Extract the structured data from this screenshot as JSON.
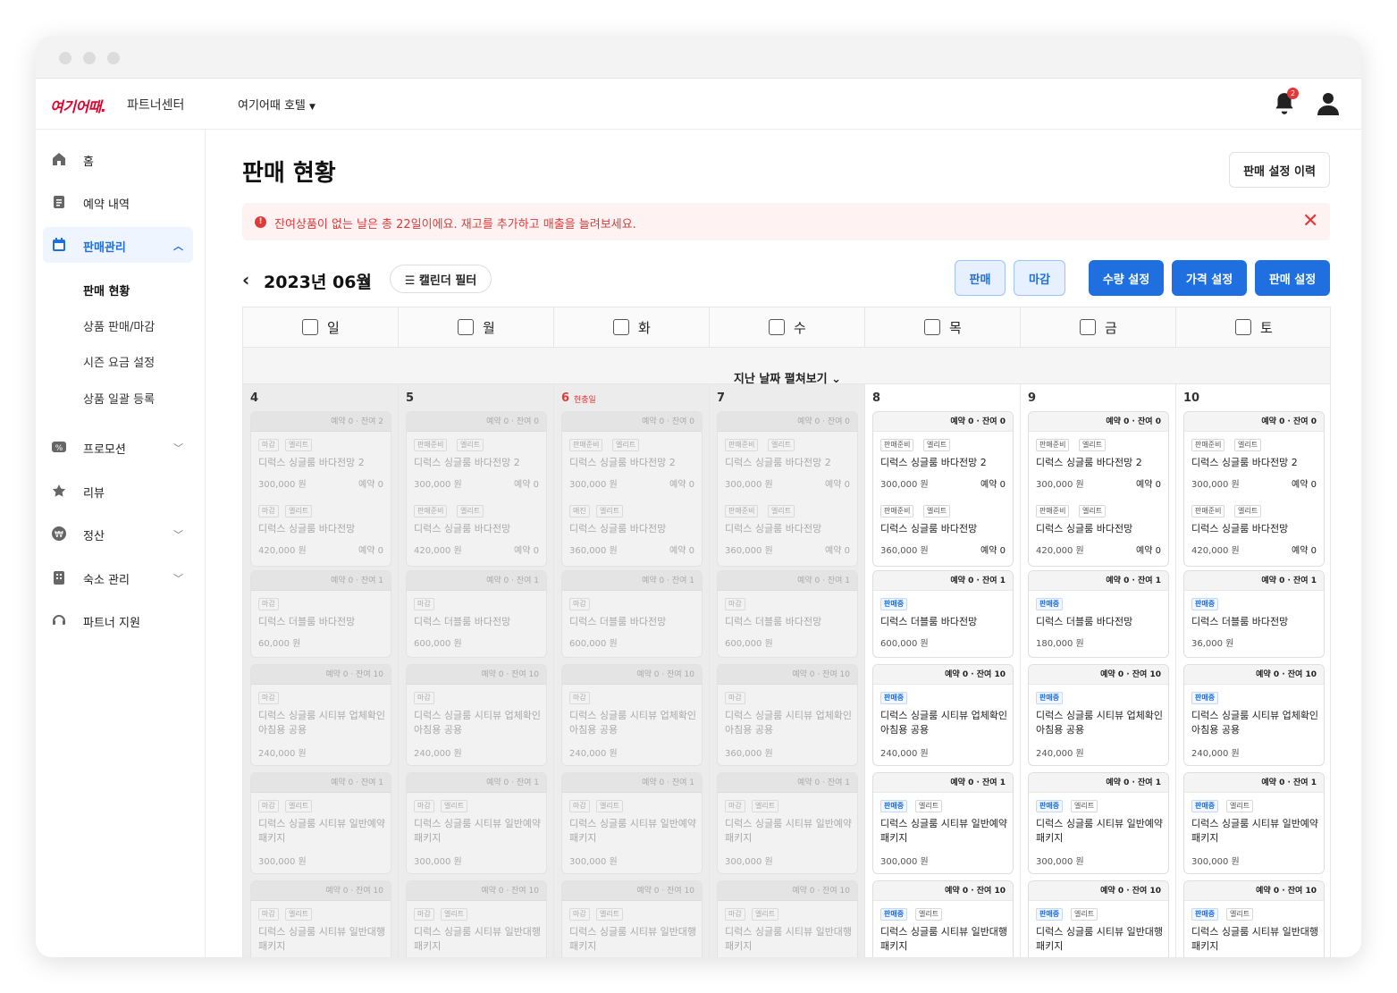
{
  "app": {
    "logo": "여기어때.",
    "logo_sub": "파트너센터",
    "hotel": "여기어때 호텔",
    "notif_count": "2"
  },
  "colors": {
    "accent": "#1f6fe0",
    "danger": "#e23838"
  },
  "sidebar": {
    "items": [
      {
        "label": "홈",
        "icon": "home-icon"
      },
      {
        "label": "예약 내역",
        "icon": "document-icon"
      },
      {
        "label": "판매관리",
        "icon": "calendar-icon"
      },
      {
        "label": "프로모션",
        "icon": "percent-icon"
      },
      {
        "label": "리뷰",
        "icon": "star-icon"
      },
      {
        "label": "정산",
        "icon": "won-icon"
      },
      {
        "label": "숙소 관리",
        "icon": "building-icon"
      },
      {
        "label": "파트너 지원",
        "icon": "headset-icon"
      }
    ],
    "subitems": [
      "판매 현황",
      "상품 판매/마감",
      "시즌 요금 설정",
      "상품 일괄 등록"
    ]
  },
  "main": {
    "title": "판매 현황",
    "history_button": "판매 설정 이력",
    "alert": "잔여상품이 없는 날은 총 22일이에요. 재고를 추가하고 매출을 늘려보세요.",
    "month": "2023년 06월",
    "filter_button": "캘린더 필터",
    "buttons": [
      "판매",
      "마감",
      "수량 설정",
      "가격 설정",
      "판매 설정"
    ],
    "expand_label": "지난 날짜 펼쳐보기"
  },
  "calendar": {
    "weekdays": [
      "일",
      "월",
      "화",
      "수",
      "목",
      "금",
      "토"
    ],
    "today_label": "현충일",
    "days": [
      {
        "num": "4",
        "past": true,
        "cards": [
          {
            "top": "예약 0 · 잔여 2",
            "rows": [
              {
                "tags": [
                  "마감",
                  "엘리트"
                ],
                "name": "디럭스 싱글룸 바다전망 2",
                "price": "300,000 원",
                "resv": "예약 0"
              },
              {
                "tags": [
                  "마감",
                  "엘리트"
                ],
                "name": "디럭스 싱글룸 바다전망",
                "price": "420,000 원",
                "resv": "예약 0"
              }
            ]
          },
          {
            "top": "예약 0 · 잔여 1",
            "rows": [
              {
                "tags": [
                  "마감"
                ],
                "name": "디럭스 더블룸 바다전망",
                "price": "60,000 원"
              }
            ]
          },
          {
            "top": "예약 0 · 잔여 10",
            "rows": [
              {
                "tags": [
                  "마감"
                ],
                "name": "디럭스 싱글룸 시티뷰 업체확인 아침용 공용",
                "price": "240,000 원"
              }
            ]
          },
          {
            "top": "예약 0 · 잔여 1",
            "rows": [
              {
                "tags": [
                  "마감",
                  "엘리트"
                ],
                "name": "디럭스 싱글룸 시티뷰 일반예약 패키지",
                "price": "300,000 원"
              }
            ]
          },
          {
            "top": "예약 0 · 잔여 10",
            "rows": [
              {
                "tags": [
                  "마감",
                  "엘리트"
                ],
                "name": "디럭스 싱글룸 시티뷰 일반대행 패키지"
              }
            ]
          }
        ]
      },
      {
        "num": "5",
        "past": true,
        "cards": [
          {
            "top": "예약 0 · 잔여 0",
            "rows": [
              {
                "tags": [
                  "판매준비",
                  "엘리트"
                ],
                "name": "디럭스 싱글룸 바다전망 2",
                "price": "300,000 원",
                "resv": "예약 0"
              },
              {
                "tags": [
                  "판매준비",
                  "엘리트"
                ],
                "name": "디럭스 싱글룸 바다전망",
                "price": "420,000 원",
                "resv": "예약 0"
              }
            ]
          },
          {
            "top": "예약 0 · 잔여 1",
            "rows": [
              {
                "tags": [
                  "마감"
                ],
                "name": "디럭스 더블룸 바다전망",
                "price": "600,000 원"
              }
            ]
          },
          {
            "top": "예약 0 · 잔여 10",
            "rows": [
              {
                "tags": [
                  "마감"
                ],
                "name": "디럭스 싱글룸 시티뷰 업체확인 아침용 공용",
                "price": "240,000 원"
              }
            ]
          },
          {
            "top": "예약 0 · 잔여 1",
            "rows": [
              {
                "tags": [
                  "마감",
                  "엘리트"
                ],
                "name": "디럭스 싱글룸 시티뷰 일반예약 패키지",
                "price": "300,000 원"
              }
            ]
          },
          {
            "top": "예약 0 · 잔여 10",
            "rows": [
              {
                "tags": [
                  "마감",
                  "엘리트"
                ],
                "name": "디럭스 싱글룸 시티뷰 일반대행 패키지"
              }
            ]
          }
        ]
      },
      {
        "num": "6",
        "past": true,
        "red": true,
        "cards": [
          {
            "top": "예약 0 · 잔여 0",
            "rows": [
              {
                "tags": [
                  "판매준비",
                  "엘리트"
                ],
                "name": "디럭스 싱글룸 바다전망 2",
                "price": "300,000 원",
                "resv": "예약 0"
              },
              {
                "tags": [
                  "매진",
                  "엘리트"
                ],
                "name": "디럭스 싱글룸 바다전망",
                "price": "360,000 원",
                "resv": "예약 0"
              }
            ]
          },
          {
            "top": "예약 0 · 잔여 1",
            "rows": [
              {
                "tags": [
                  "마감"
                ],
                "name": "디럭스 더블룸 바다전망",
                "price": "600,000 원"
              }
            ]
          },
          {
            "top": "예약 0 · 잔여 10",
            "rows": [
              {
                "tags": [
                  "마감"
                ],
                "name": "디럭스 싱글룸 시티뷰 업체확인 아침용 공용",
                "price": "240,000 원"
              }
            ]
          },
          {
            "top": "예약 0 · 잔여 1",
            "rows": [
              {
                "tags": [
                  "마감",
                  "엘리트"
                ],
                "name": "디럭스 싱글룸 시티뷰 일반예약 패키지",
                "price": "300,000 원"
              }
            ]
          },
          {
            "top": "예약 0 · 잔여 10",
            "rows": [
              {
                "tags": [
                  "마감",
                  "엘리트"
                ],
                "name": "디럭스 싱글룸 시티뷰 일반대행 패키지"
              }
            ]
          }
        ]
      },
      {
        "num": "7",
        "past": true,
        "cards": [
          {
            "top": "예약 0 · 잔여 0",
            "rows": [
              {
                "tags": [
                  "판매준비",
                  "엘리트"
                ],
                "name": "디럭스 싱글룸 바다전망 2",
                "price": "300,000 원",
                "resv": "예약 0"
              },
              {
                "tags": [
                  "판매준비",
                  "엘리트"
                ],
                "name": "디럭스 싱글룸 바다전망",
                "price": "360,000 원",
                "resv": "예약 0"
              }
            ]
          },
          {
            "top": "예약 0 · 잔여 1",
            "rows": [
              {
                "tags": [
                  "마감"
                ],
                "name": "디럭스 더블룸 바다전망",
                "price": "600,000 원"
              }
            ]
          },
          {
            "top": "예약 0 · 잔여 10",
            "rows": [
              {
                "tags": [
                  "마감"
                ],
                "name": "디럭스 싱글룸 시티뷰 업체확인 아침용 공용",
                "price": "360,000 원"
              }
            ]
          },
          {
            "top": "예약 0 · 잔여 1",
            "rows": [
              {
                "tags": [
                  "마감",
                  "엘리트"
                ],
                "name": "디럭스 싱글룸 시티뷰 일반예약 패키지",
                "price": "300,000 원"
              }
            ]
          },
          {
            "top": "예약 0 · 잔여 10",
            "rows": [
              {
                "tags": [
                  "마감",
                  "엘리트"
                ],
                "name": "디럭스 싱글룸 시티뷰 일반대행 패키지"
              }
            ]
          }
        ]
      },
      {
        "num": "8",
        "past": false,
        "cards": [
          {
            "top": "예약 0 · 잔여 0",
            "rows": [
              {
                "tags": [
                  "판매준비",
                  "엘리트"
                ],
                "name": "디럭스 싱글룸 바다전망 2",
                "price": "300,000 원",
                "resv": "예약 0"
              },
              {
                "tags": [
                  "판매준비",
                  "엘리트"
                ],
                "name": "디럭스 싱글룸 바다전망",
                "price": "360,000 원",
                "resv": "예약 0"
              }
            ]
          },
          {
            "top": "예약 0 · 잔여 1",
            "rows": [
              {
                "tags": [
                  "판매중"
                ],
                "name": "디럭스 더블룸 바다전망",
                "price": "600,000 원"
              }
            ]
          },
          {
            "top": "예약 0 · 잔여 10",
            "rows": [
              {
                "tags": [
                  "판매중"
                ],
                "name": "디럭스 싱글룸 시티뷰 업체확인 아침용 공용",
                "price": "240,000 원"
              }
            ]
          },
          {
            "top": "예약 0 · 잔여 1",
            "rows": [
              {
                "tags": [
                  "판매중",
                  "엘리트"
                ],
                "name": "디럭스 싱글룸 시티뷰 일반예약 패키지",
                "price": "300,000 원"
              }
            ]
          },
          {
            "top": "예약 0 · 잔여 10",
            "rows": [
              {
                "tags": [
                  "판매중",
                  "엘리트"
                ],
                "name": "디럭스 싱글룸 시티뷰 일반대행 패키지"
              }
            ]
          }
        ]
      },
      {
        "num": "9",
        "past": false,
        "cards": [
          {
            "top": "예약 0 · 잔여 0",
            "rows": [
              {
                "tags": [
                  "판매준비",
                  "엘리트"
                ],
                "name": "디럭스 싱글룸 바다전망 2",
                "price": "300,000 원",
                "resv": "예약 0"
              },
              {
                "tags": [
                  "판매준비",
                  "엘리트"
                ],
                "name": "디럭스 싱글룸 바다전망",
                "price": "420,000 원",
                "resv": "예약 0"
              }
            ]
          },
          {
            "top": "예약 0 · 잔여 1",
            "rows": [
              {
                "tags": [
                  "판매중"
                ],
                "name": "디럭스 더블룸 바다전망",
                "price": "180,000 원"
              }
            ]
          },
          {
            "top": "예약 0 · 잔여 10",
            "rows": [
              {
                "tags": [
                  "판매중"
                ],
                "name": "디럭스 싱글룸 시티뷰 업체확인 아침용 공용",
                "price": "240,000 원"
              }
            ]
          },
          {
            "top": "예약 0 · 잔여 1",
            "rows": [
              {
                "tags": [
                  "판매중",
                  "엘리트"
                ],
                "name": "디럭스 싱글룸 시티뷰 일반예약 패키지",
                "price": "300,000 원"
              }
            ]
          },
          {
            "top": "예약 0 · 잔여 10",
            "rows": [
              {
                "tags": [
                  "판매중",
                  "엘리트"
                ],
                "name": "디럭스 싱글룸 시티뷰 일반대행 패키지"
              }
            ]
          }
        ]
      },
      {
        "num": "10",
        "past": false,
        "cards": [
          {
            "top": "예약 0 · 잔여 0",
            "rows": [
              {
                "tags": [
                  "판매준비",
                  "엘리트"
                ],
                "name": "디럭스 싱글룸 바다전망 2",
                "price": "300,000 원",
                "resv": "예약 0"
              },
              {
                "tags": [
                  "판매준비",
                  "엘리트"
                ],
                "name": "디럭스 싱글룸 바다전망",
                "price": "420,000 원",
                "resv": "예약 0"
              }
            ]
          },
          {
            "top": "예약 0 · 잔여 1",
            "rows": [
              {
                "tags": [
                  "판매중"
                ],
                "name": "디럭스 더블룸 바다전망",
                "price": "36,000 원"
              }
            ]
          },
          {
            "top": "예약 0 · 잔여 10",
            "rows": [
              {
                "tags": [
                  "판매중"
                ],
                "name": "디럭스 싱글룸 시티뷰 업체확인 아침용 공용",
                "price": "240,000 원"
              }
            ]
          },
          {
            "top": "예약 0 · 잔여 1",
            "rows": [
              {
                "tags": [
                  "판매중",
                  "엘리트"
                ],
                "name": "디럭스 싱글룸 시티뷰 일반예약 패키지",
                "price": "300,000 원"
              }
            ]
          },
          {
            "top": "예약 0 · 잔여 10",
            "rows": [
              {
                "tags": [
                  "판매중",
                  "엘리트"
                ],
                "name": "디럭스 싱글룸 시티뷰 일반대행 패키지"
              }
            ]
          }
        ]
      }
    ]
  }
}
